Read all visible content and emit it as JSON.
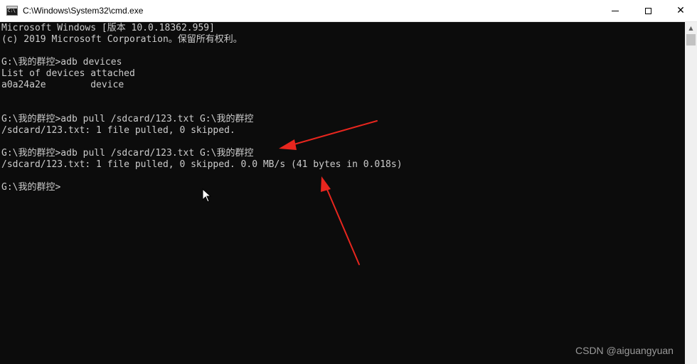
{
  "window": {
    "title": "C:\\Windows\\System32\\cmd.exe",
    "icon": "cmd-icon",
    "icon_text": "C:\\",
    "controls": {
      "minimize": "minimize-icon",
      "maximize": "maximize-icon",
      "close": "close-icon",
      "close_glyph": "✕"
    }
  },
  "console": {
    "background": "#0c0c0c",
    "foreground": "#cccccc",
    "lines": [
      "Microsoft Windows [版本 10.0.18362.959]",
      "(c) 2019 Microsoft Corporation。保留所有权利。",
      "",
      "G:\\我的群控>adb devices",
      "List of devices attached",
      "a0a24a2e        device",
      "",
      "",
      "G:\\我的群控>adb pull /sdcard/123.txt G:\\我的群控",
      "/sdcard/123.txt: 1 file pulled, 0 skipped.",
      "",
      "G:\\我的群控>adb pull /sdcard/123.txt G:\\我的群控",
      "/sdcard/123.txt: 1 file pulled, 0 skipped. 0.0 MB/s (41 bytes in 0.018s)",
      "",
      "G:\\我的群控>"
    ]
  },
  "scrollbar": {
    "up_glyph": "▲"
  },
  "annotations": {
    "color": "#e8261e",
    "arrows": [
      "red-arrow-to-command",
      "red-arrow-to-transfer-stats"
    ]
  },
  "watermark": {
    "text": "CSDN @aiguangyuan"
  }
}
